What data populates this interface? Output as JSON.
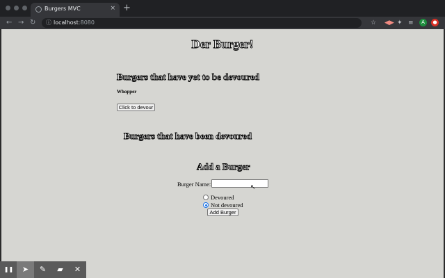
{
  "browser": {
    "tab_title": "Burgers MVC",
    "new_tab_glyph": "+",
    "tab_close_glyph": "×",
    "url_host": "localhost",
    "url_port": ":8080",
    "extension_avatar_letter": "A"
  },
  "page": {
    "heading": "Der Burger!",
    "not_devoured_heading": "Burgers that have yet to be devoured",
    "uneaten_burgers": [
      {
        "name": "Whopper",
        "button_label": "Click to devour"
      }
    ],
    "devoured_heading": "Burgers that have been devoured",
    "form": {
      "heading": "Add a Burger",
      "name_label": "Burger Name:",
      "name_value": "",
      "radio_devoured_label": "Devoured",
      "radio_not_devoured_label": "Not devoured",
      "selected": "Not devoured",
      "submit_label": "Add Burger"
    }
  },
  "icons": {
    "back": "←",
    "forward": "→",
    "reload": "↻",
    "lock": "ⓘ",
    "star": "☆",
    "puzzle": "✦",
    "list": "≡",
    "menu": "⋮",
    "pause": "❚❚",
    "pointer": "➤",
    "pen": "✎",
    "eraser": "▰",
    "close": "✕"
  },
  "colors": {
    "page_background": "#d6d6d2",
    "radio_accent": "#1a73e8",
    "avatar_green": "#1e8e3e",
    "avatar_red": "#d93025"
  }
}
